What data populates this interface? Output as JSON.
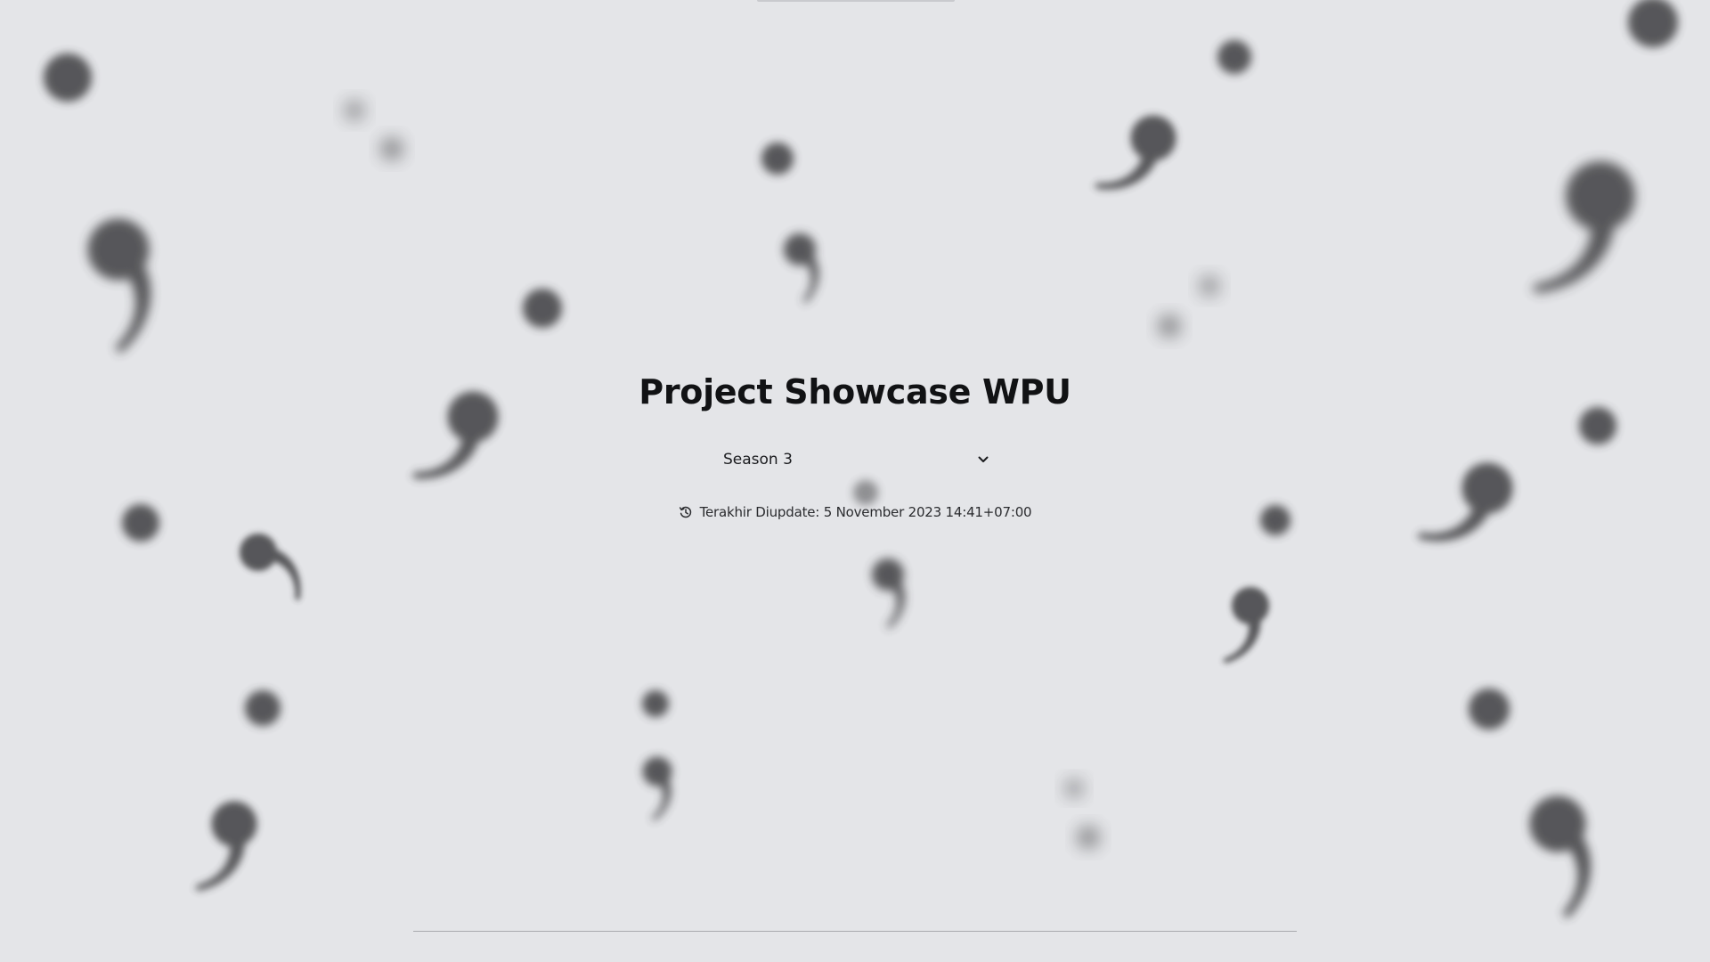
{
  "page": {
    "title": "Project Showcase WPU",
    "season_select": {
      "selected": "Season 3"
    },
    "last_updated": {
      "label": "Terakhir Diupdate: 5 November 2023 14:41+07:00",
      "icon": "history-icon"
    }
  },
  "background": {
    "pattern": "blurred-comma-and-dot-glyphs",
    "color": "#e4e5e8",
    "glyph_color": "#3a3a3d"
  }
}
